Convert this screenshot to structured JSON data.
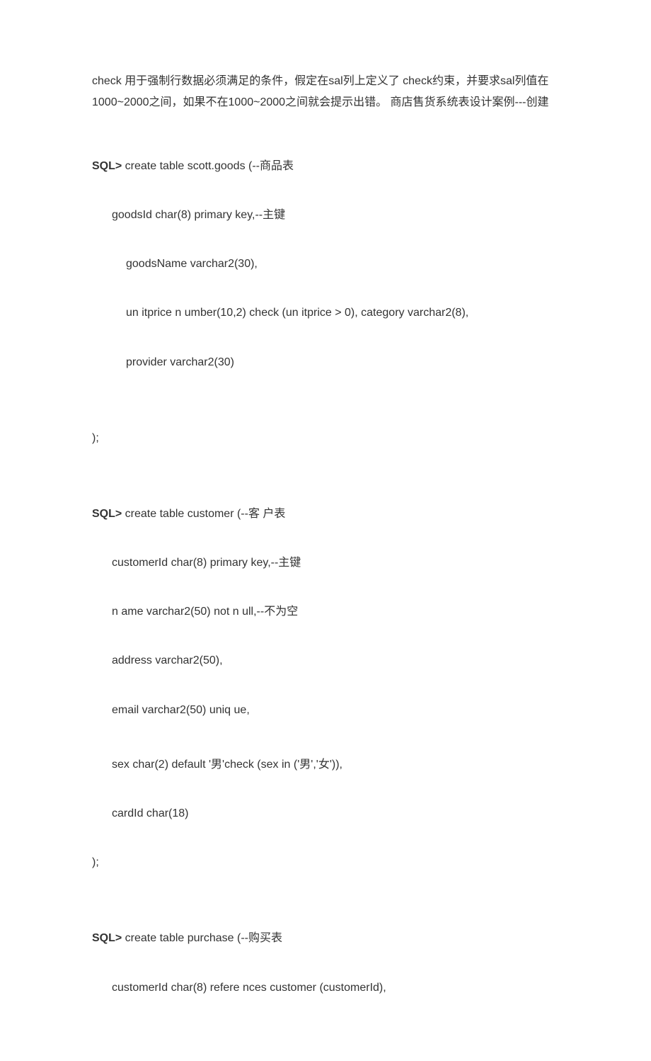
{
  "intro": "check 用于强制行数据必须满足的条件，假定在sal列上定义了 check约束，并要求sal列值在1000~2000之间，如果不在1000~2000之间就会提示出错。  商店售货系统表设计案例---创建",
  "sql1": {
    "prompt": "SQL>",
    "line1_rest": " create table scott.goods (--商品表",
    "line2": "goodsId char(8) primary key,--主键",
    "line3": "goodsName varchar2(30),",
    "line4": "un itprice n umber(10,2) check (un itprice > 0), category varchar2(8),",
    "line5": "provider varchar2(30)",
    "line6": ");"
  },
  "sql2": {
    "prompt": "SQL>",
    "line1_rest": " create table customer (--客 户表",
    "line2": "customerId char(8) primary key,--主键",
    "line3": "n ame varchar2(50) not n ull,--不为空",
    "line4": "address varchar2(50),",
    "line5": "email varchar2(50) uniq ue,",
    "line6": "sex char(2) default '男'check (sex in ('男','女')),",
    "line7": "cardId char(18)",
    "line8": ");"
  },
  "sql3": {
    "prompt": "SQL>",
    "line1_rest": " create table purchase (--购买表",
    "line2": "customerId char(8) refere nces customer (customerId),"
  }
}
